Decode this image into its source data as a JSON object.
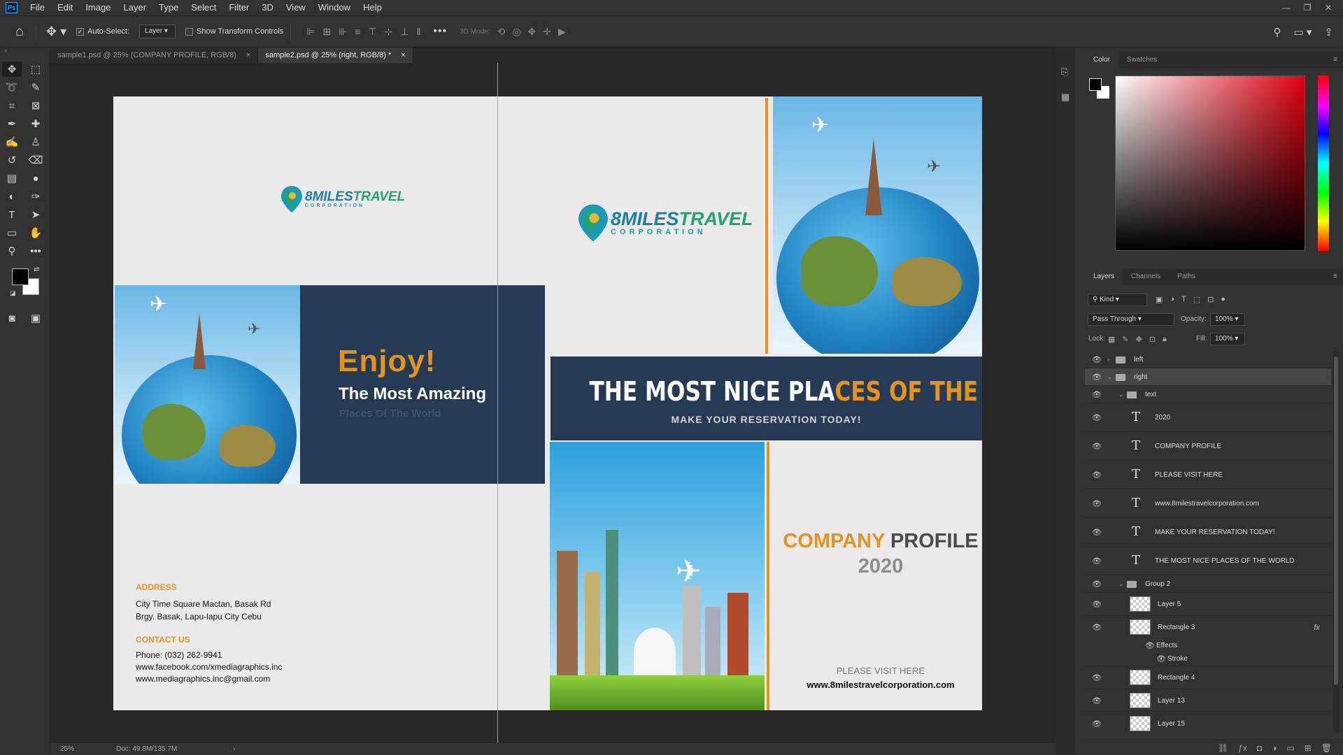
{
  "menubar": {
    "app_logo": "Ps",
    "items": [
      "File",
      "Edit",
      "Image",
      "Layer",
      "Type",
      "Select",
      "Filter",
      "3D",
      "View",
      "Window",
      "Help"
    ]
  },
  "options": {
    "auto_select_label": "Auto-Select:",
    "auto_select_value": "Layer",
    "show_transform_label": "Show Transform Controls",
    "mode_3d_label": "3D Mode:"
  },
  "tabs": [
    {
      "label": "sample1.psd @ 25% (COMPANY PROFILE, RGB/8)",
      "close": "×"
    },
    {
      "label": "sample2.psd @ 25% (right, RGB/8) *",
      "close": "×"
    }
  ],
  "status": {
    "zoom": "25%",
    "doc": "Doc: 49.8M/135.7M",
    "arrow": "›"
  },
  "document": {
    "logo": {
      "brand_miles": "8MILES",
      "brand_travel": "TRAVEL",
      "sub": "CORPORATION"
    },
    "enjoy": "Enjoy!",
    "most_amazing": "The Most Amazing",
    "places": "Places Of The World",
    "address_heading": "ADDRESS",
    "address_line1": "City Time Square Mactan, Basak Rd",
    "address_line2": "Brgy. Basak, Lapu-lapu City Cebu",
    "contact_heading": "CONTACT US",
    "phone": "Phone: (032) 262-9941",
    "facebook": "www.facebook.com/xmediagraphics.inc",
    "email": "www.mediagraphics.inc@gmail.com",
    "banner_white": "THE MOST NICE PLA",
    "banner_orange": "CES OF THE WORLD",
    "banner_sub": "MAKE YOUR RESERVATION TODAY!",
    "company": "COMPANY",
    "profile": "PROFILE",
    "year": "2020",
    "please_visit": "PLEASE VISIT HERE",
    "website": "www.8milestravelcorporation.com"
  },
  "color_panel": {
    "tabs": [
      "Color",
      "Swatches"
    ]
  },
  "layers_panel": {
    "tabs": [
      "Layers",
      "Channels",
      "Paths"
    ],
    "filter": "Kind",
    "blend_mode": "Pass Through",
    "opacity_label": "Opacity:",
    "opacity": "100%",
    "lock_label": "Lock:",
    "fill_label": "Fill:",
    "fill": "100%",
    "layers": [
      {
        "name": "left"
      },
      {
        "name": "right"
      },
      {
        "name": "text"
      },
      {
        "name": "2020"
      },
      {
        "name": "COMPANY PROFILE"
      },
      {
        "name": "PLEASE VISIT HERE"
      },
      {
        "name": "www.8milestravelcorporation.com"
      },
      {
        "name": "MAKE YOUR RESERVATION TODAY!"
      },
      {
        "name": "THE MOST NICE PLACES OF THE WORLD"
      },
      {
        "name": "Group 2"
      },
      {
        "name": "Layer 5"
      },
      {
        "name": "Rectangle 3"
      },
      {
        "name": "Effects"
      },
      {
        "name": "Stroke"
      },
      {
        "name": "Rectangle 4"
      },
      {
        "name": "Layer 13"
      },
      {
        "name": "Layer 15"
      }
    ],
    "fx": "fx"
  },
  "colors": {
    "accent_orange": "#e5931f",
    "navy": "#263a53",
    "guide": "#28d0e8",
    "brand_teal": "#1b9bb3"
  }
}
